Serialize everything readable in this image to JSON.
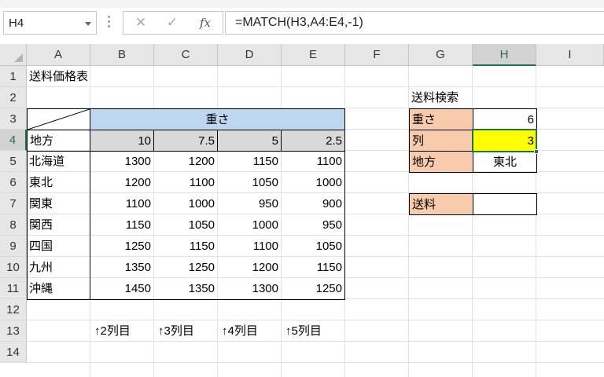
{
  "formula_bar": {
    "name_box": "H4",
    "cancel_icon": "✕",
    "enter_icon": "✓",
    "fx_label": "fx",
    "formula": "=MATCH(H3,A4:E4,-1)"
  },
  "columns": [
    "A",
    "B",
    "C",
    "D",
    "E",
    "F",
    "G",
    "H",
    "I"
  ],
  "rows": [
    "1",
    "2",
    "3",
    "4",
    "5",
    "6",
    "7",
    "8",
    "9",
    "10",
    "11",
    "12",
    "13",
    "14"
  ],
  "selected_cell": {
    "column": "H",
    "row": "4"
  },
  "sheet": {
    "title": "送料価格表",
    "weight_header": "重さ",
    "region_header": "地方",
    "weights": [
      "10",
      "7.5",
      "5",
      "2.5"
    ],
    "table_rows": [
      {
        "region": "北海道",
        "prices": [
          "1300",
          "1200",
          "1150",
          "1100"
        ]
      },
      {
        "region": "東北",
        "prices": [
          "1200",
          "1100",
          "1050",
          "1000"
        ]
      },
      {
        "region": "関東",
        "prices": [
          "1100",
          "1000",
          "950",
          "900"
        ]
      },
      {
        "region": "関西",
        "prices": [
          "1150",
          "1050",
          "1000",
          "950"
        ]
      },
      {
        "region": "四国",
        "prices": [
          "1250",
          "1150",
          "1100",
          "1050"
        ]
      },
      {
        "region": "九州",
        "prices": [
          "1350",
          "1250",
          "1200",
          "1150"
        ]
      },
      {
        "region": "沖縄",
        "prices": [
          "1450",
          "1350",
          "1300",
          "1250"
        ]
      }
    ],
    "column_notes": [
      "↑2列目",
      "↑3列目",
      "↑4列目",
      "↑5列目"
    ],
    "lookup": {
      "title": "送料検索",
      "weight_label": "重さ",
      "weight_value": "6",
      "column_label": "列",
      "column_value": "3",
      "region_label": "地方",
      "region_value": "東北",
      "fee_label": "送料",
      "fee_value": ""
    }
  },
  "colors": {
    "header_blue": "#bdd7ee",
    "header_gray": "#d9d9d9",
    "label_peach": "#f8cbad",
    "highlight_yellow": "#ffff00",
    "selection_green": "#217346"
  }
}
